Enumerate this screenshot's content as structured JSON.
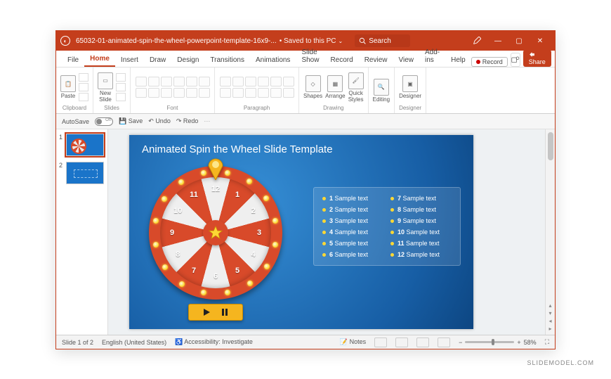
{
  "titlebar": {
    "filename": "65032-01-animated-spin-the-wheel-powerpoint-template-16x9-...",
    "saved_status": "Saved to this PC",
    "search_placeholder": "Search",
    "min": "—",
    "max": "▢",
    "close": "✕",
    "draw_icon": "⌕"
  },
  "tabs": {
    "file": "File",
    "home": "Home",
    "insert": "Insert",
    "draw": "Draw",
    "design": "Design",
    "transitions": "Transitions",
    "animations": "Animations",
    "slideshow": "Slide Show",
    "record": "Record",
    "review": "Review",
    "view": "View",
    "addins": "Add-ins",
    "help": "Help",
    "record_btn": "Record",
    "share": "Share"
  },
  "ribbon": {
    "paste": "Paste",
    "clipboard": "Clipboard",
    "new_slide": "New\nSlide",
    "slides": "Slides",
    "font": "Font",
    "paragraph": "Paragraph",
    "shapes": "Shapes",
    "arrange": "Arrange",
    "quick_styles": "Quick\nStyles",
    "drawing": "Drawing",
    "editing": "Editing",
    "designer": "Designer",
    "designer_g": "Designer"
  },
  "autosave_row": {
    "autosave": "AutoSave",
    "off": "Off",
    "save": "Save",
    "undo": "Undo",
    "redo": "Redo"
  },
  "thumbs": {
    "n1": "1",
    "n2": "2"
  },
  "slide": {
    "title": "Animated Spin the Wheel Slide Template",
    "wheel_numbers": [
      "12",
      "1",
      "2",
      "3",
      "4",
      "5",
      "6",
      "7",
      "8",
      "9",
      "10",
      "11"
    ],
    "legend": [
      {
        "n": "1",
        "t": "Sample text"
      },
      {
        "n": "2",
        "t": "Sample text"
      },
      {
        "n": "3",
        "t": "Sample text"
      },
      {
        "n": "4",
        "t": "Sample text"
      },
      {
        "n": "5",
        "t": "Sample text"
      },
      {
        "n": "6",
        "t": "Sample text"
      },
      {
        "n": "7",
        "t": "Sample text"
      },
      {
        "n": "8",
        "t": "Sample text"
      },
      {
        "n": "9",
        "t": "Sample text"
      },
      {
        "n": "10",
        "t": "Sample text"
      },
      {
        "n": "11",
        "t": "Sample text"
      },
      {
        "n": "12",
        "t": "Sample text"
      }
    ]
  },
  "status": {
    "slide": "Slide 1 of 2",
    "lang": "English (United States)",
    "accessibility": "Accessibility: Investigate",
    "notes": "Notes",
    "zoom_minus": "−",
    "zoom_plus": "+",
    "zoom_pct": "58%"
  },
  "watermark": "SLIDEMODEL.COM"
}
